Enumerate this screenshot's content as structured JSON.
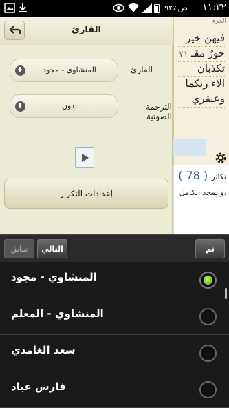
{
  "status_bar": {
    "time": "١١:٢٢",
    "ampm": "ص",
    "battery": "٩٢٪"
  },
  "background": {
    "page_header": "الجزء",
    "verse_lines": [
      "فيهن خير",
      "حورٌ مقـ",
      "تكذبان",
      "الاء ربكما",
      "وعبقري"
    ],
    "ayah_marker": "٧١",
    "verse_number": "( 78 )",
    "verse_text": "تكاثر",
    "tafsir_snippet": "والمجد الكامل،"
  },
  "panel": {
    "title": "القارئ",
    "reciter_label": "القارئ",
    "reciter_value": "المنشاوي - مجود",
    "translation_label": "الترجمة الصوتية",
    "translation_value": "بدون",
    "repeat_settings": "إعدادات التكرار"
  },
  "picker": {
    "prev_label": "سابق",
    "next_label": "التالي",
    "done_label": "تم",
    "options": [
      {
        "label": "المنشاوي - مجود",
        "selected": true
      },
      {
        "label": "المنشاوي - المعلم",
        "selected": false
      },
      {
        "label": "سعد الغامدي",
        "selected": false
      },
      {
        "label": "فارس عباد",
        "selected": false
      }
    ]
  },
  "colors": {
    "panel_bg": "#ecebd3",
    "picker_bg": "#1a1a1a",
    "radio_selected": "#7ed321",
    "verse_blue": "#2f5d9e"
  }
}
